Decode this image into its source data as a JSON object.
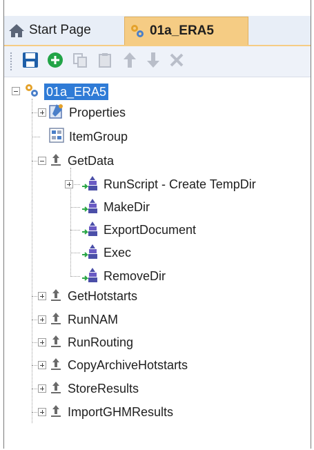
{
  "tabs": {
    "start_label": "Start Page",
    "active_label": "01a_ERA5"
  },
  "toolbar": {
    "buttons": [
      "save-icon",
      "add-icon",
      "copy-icon",
      "paste-icon",
      "move-up-icon",
      "move-down-icon",
      "delete-icon"
    ]
  },
  "tree": {
    "root": "01a_ERA5",
    "properties": "Properties",
    "itemgroup": "ItemGroup",
    "getdata": "GetData",
    "getdata_children": [
      "RunScript - Create TempDir",
      "MakeDir",
      "ExportDocument",
      "Exec",
      "RemoveDir"
    ],
    "targets": [
      "GetHotstarts",
      "RunNAM",
      "RunRouting",
      "CopyArchiveHotstarts",
      "StoreResults",
      "ImportGHMResults"
    ]
  },
  "colors": {
    "selection": "#2f7bd6",
    "active_tab": "#f5cc84",
    "save_blue": "#1f5fa8",
    "add_green": "#22a447"
  }
}
